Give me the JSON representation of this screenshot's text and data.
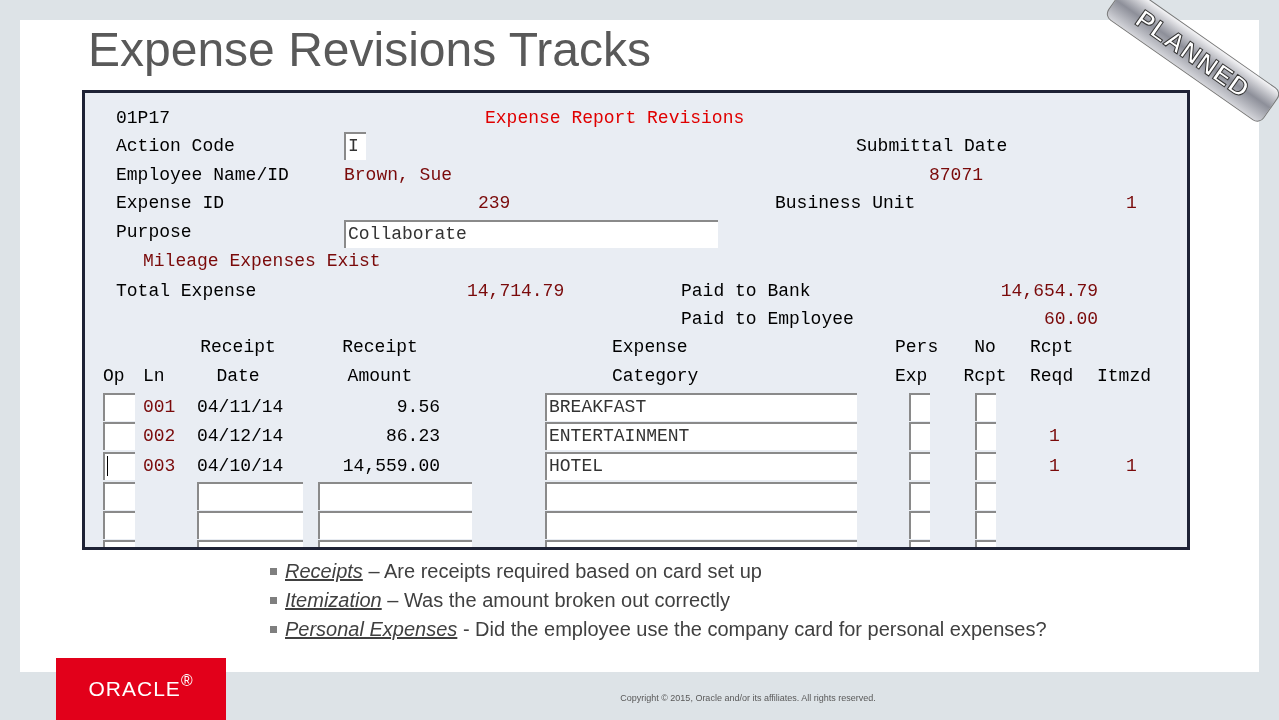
{
  "slide": {
    "title": "Expense Revisions Tracks",
    "ribbon": "PLANNED"
  },
  "terminal": {
    "program_id": "01P17",
    "screen_title": "Expense Report Revisions",
    "action_code": {
      "label": "Action Code",
      "value": "I"
    },
    "submittal_date": {
      "label": "Submittal Date"
    },
    "employee": {
      "label": "Employee Name/ID",
      "name": "Brown, Sue",
      "id": "87071"
    },
    "expense_id": {
      "label": "Expense ID",
      "value": "239"
    },
    "business_unit": {
      "label": "Business Unit",
      "value": "1"
    },
    "purpose": {
      "label": "Purpose",
      "value": "Collaborate"
    },
    "message": "Mileage Expenses Exist",
    "total_expense": {
      "label": "Total Expense",
      "value": "14,714.79"
    },
    "paid_to_bank": {
      "label": "Paid to Bank",
      "value": "14,654.79"
    },
    "paid_to_employee": {
      "label": "Paid to Employee",
      "value": "60.00"
    },
    "columns": [
      {
        "heading": [
          "Op"
        ]
      },
      {
        "heading": [
          "Ln"
        ]
      },
      {
        "heading": [
          "Receipt",
          "Date"
        ]
      },
      {
        "heading": [
          "Receipt",
          "Amount"
        ]
      },
      {
        "heading": [
          "Expense",
          "Category"
        ]
      },
      {
        "heading": [
          "Pers",
          "Exp"
        ]
      },
      {
        "heading": [
          "No",
          "Rcpt"
        ]
      },
      {
        "heading": [
          "Rcpt",
          "Reqd"
        ]
      },
      {
        "heading": [
          "Itmzd"
        ]
      }
    ],
    "rows": [
      {
        "kind": "entry",
        "cursor": false,
        "ln": "001",
        "date": "04/11/14",
        "amount": "9.56",
        "category": "BREAKFAST"
      },
      {
        "kind": "entry",
        "cursor": false,
        "ln": "002",
        "date": "04/12/14",
        "amount": "86.23",
        "category": "ENTERTAINMENT",
        "rcpt_reqd": "1"
      },
      {
        "kind": "entry",
        "cursor": true,
        "ln": "003",
        "date": "04/10/14",
        "amount": "14,559.00",
        "category": "HOTEL",
        "rcpt_reqd": "1",
        "itmzd": "1"
      },
      {
        "kind": "blank",
        "cursor": false
      },
      {
        "kind": "blank",
        "cursor": false
      },
      {
        "kind": "blank",
        "cursor": false
      }
    ]
  },
  "bullets": [
    {
      "term": "Receipts",
      "text": "– Are receipts required based on card set up"
    },
    {
      "term": "Itemization",
      "text": "– Was the amount broken out correctly"
    },
    {
      "term": "Personal Expenses",
      "text": "- Did the employee use the company card for personal expenses?"
    }
  ],
  "footer": {
    "logo": "ORACLE$^{®}$",
    "copyright": "Copyright © 2015, Oracle and/or its affiliates. All rights reserved."
  }
}
